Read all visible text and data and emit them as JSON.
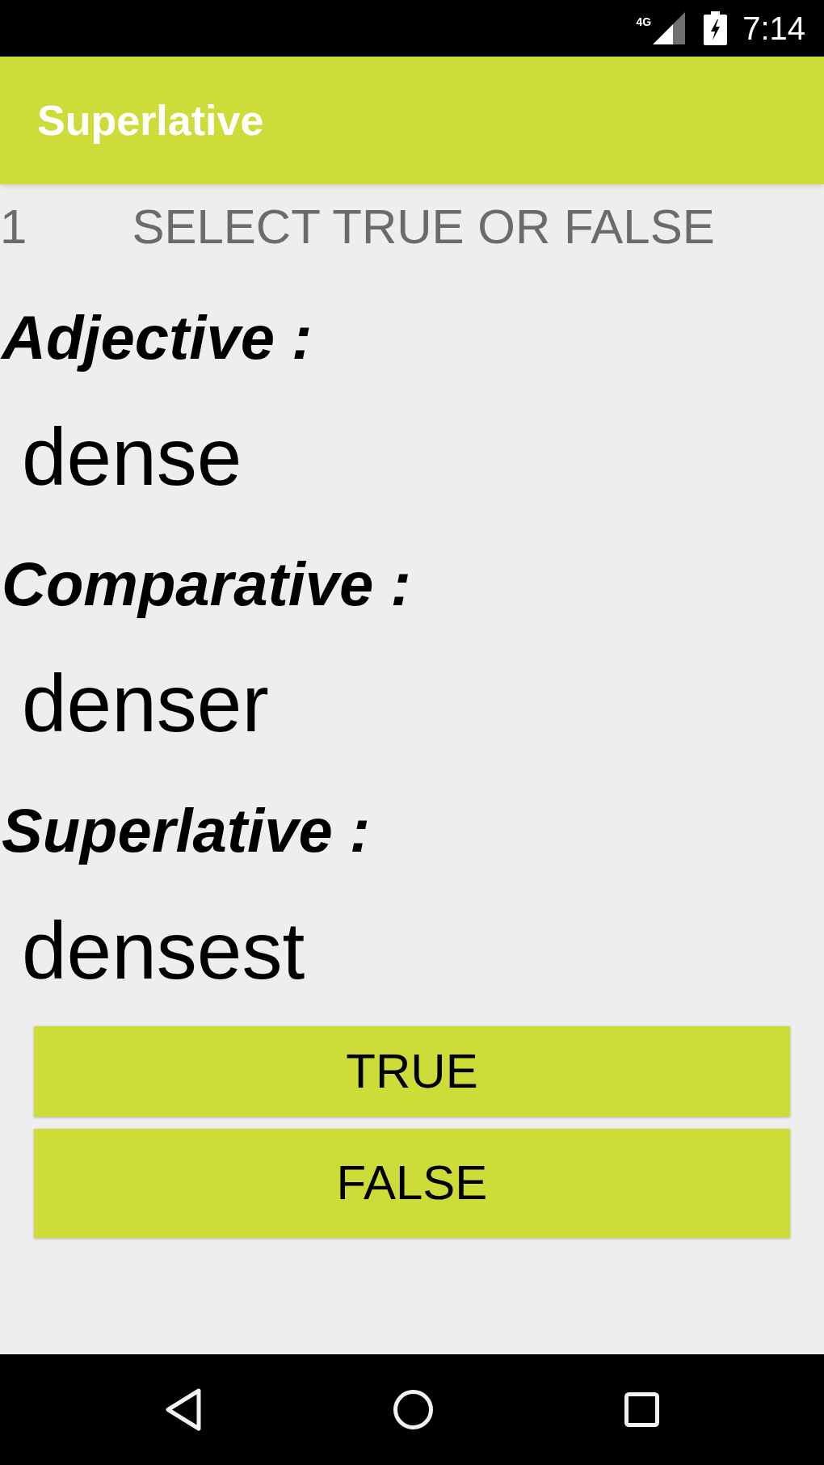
{
  "status_bar": {
    "network": "4G",
    "time": "7:14"
  },
  "app_bar": {
    "title": "Superlative"
  },
  "question": {
    "number": "1",
    "instruction": "SELECT TRUE OR FALSE"
  },
  "forms": [
    {
      "label": "Adjective :",
      "value": "dense"
    },
    {
      "label": "Comparative :",
      "value": "denser"
    },
    {
      "label": "Superlative :",
      "value": "densest"
    }
  ],
  "buttons": [
    {
      "label": "TRUE"
    },
    {
      "label": "FALSE"
    }
  ]
}
